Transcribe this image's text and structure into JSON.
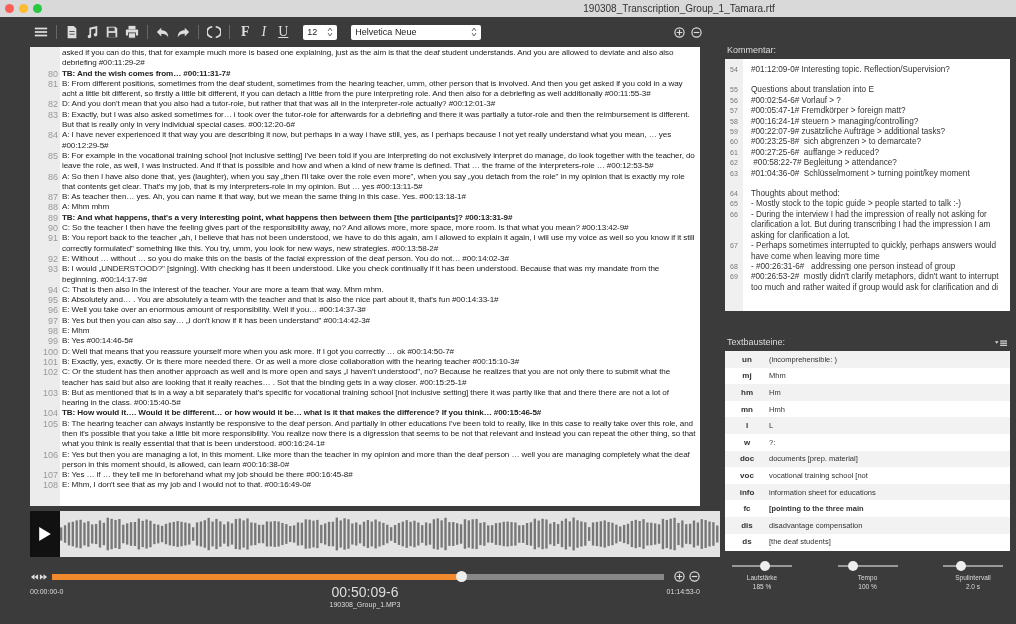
{
  "window": {
    "title": "190308_Transcription_Group_1_Tamara.rtf"
  },
  "toolbar": {
    "format_buttons": [
      {
        "label": "F",
        "kind": "bold"
      },
      {
        "label": "I",
        "kind": "italic"
      },
      {
        "label": "U",
        "kind": "underline"
      }
    ],
    "font_size": "12",
    "font": "Helvetica Neue"
  },
  "transcript": {
    "lines": [
      {
        "text": "asked if you can do this, that for example much more is based one explaining, just as the aim is that the deaf student understands. And you are allowed to deviate and also also debriefing  #00:11:29-2#",
        "bold": false
      },
      {
        "number": "80",
        "text": "TB: And the wish comes from…  #00:11:31-7#",
        "bold": true
      },
      {
        "number": "81",
        "text": "B: From different positions, sometimes from the deaf student, sometimes from the hearing teacher, umm, other person that is involved. And then you get asked if you cold in a way acht a little bit different, so firstly a little bit different, if you can detach a little from the pure interpreting role. And then also for a debriefing as well additionally  #00:11:55-3#",
        "bold": false
      },
      {
        "number": "82",
        "text": "D: And you don't mean that you also had a tutor-role, but rather that that was all in the interpreter-role actually?  #00:12:01-3#",
        "bold": false
      },
      {
        "number": "83",
        "text": "B: Exactly, but I was also asked sometimes for… i took over the tutor-role for afterwards for a debriefing and there it was partially a tutor-role and then the reimbursement is different. But that is really only in very individual special cases.  #00:12:20-6#",
        "bold": false
      },
      {
        "number": "84",
        "text": "A: I have never experienced it that way you are describing it now, but perhaps in a way i have still, yes, as I perhaps because I not yet really understand what you mean, … yes  #00:12:29-5#",
        "bold": false
      },
      {
        "number": "85",
        "text": "B: For example in the vocational training school [not inclusive setting] I've been told if you are interpreting do not exclusively interpret do manage, do look together with the teacher, do leave the role, as well, I was instructed. And if that is possible and how and when a kind of new frame is defined. That … the frame of the interpreters-role …  #00:12:53-5#",
        "bold": false
      },
      {
        "number": "86",
        "text": "A: So then I have also done that, yes (laughter), when you say „then I'll take over the role even more\", when you say „you detach from the role\" in my opinion that is exactly my role that contents get clear. That's my job, that is my interpreters-role in my opinion. But … yes #00:13:11-5#",
        "bold": false
      },
      {
        "number": "87",
        "text": "B: As teacher then… yes. Ah, you can name it that way, but we mean the same thing in this case. Yes.   #00:13:18-1#",
        "bold": false
      },
      {
        "number": "88",
        "text": "A: Mhm mhm",
        "bold": false
      },
      {
        "number": "89",
        "text": "TB: And what happens, that's a very interesting point, what happens then between them [the participants]?   #00:13:31-9#",
        "bold": true
      },
      {
        "number": "90",
        "text": "C: So the teacher I then have the feeling gives part of the responsibility away, no? And allows more, more space, more room. Is that what you mean?  #00:13:42-9#",
        "bold": false
      },
      {
        "number": "91",
        "text": "B: You report back to the teacher „ah, I believe that has not been understood, we have to do this again, am I allowed to explain it again, I will use my voice as well so you know if it still correctly formulated\" something like this. You try, umm, you look for new ways, new strategies.  #00:13:58-2#",
        "bold": false
      },
      {
        "number": "92",
        "text": "E: Without … without … so you do make this on the basis of the facial expression of the deaf person. You do not…  #00:14:02-3#",
        "bold": false
      },
      {
        "number": "93",
        "text": "B: I would „UNDERSTOOD?\" [signing]. With checking has it been understood. Like you check continually if it has been understood. Because that was my mandate from the beginning.  #00:14:17-9#",
        "bold": false
      },
      {
        "number": "94",
        "text": "C: That is then also in the interest of the teacher. Your are more a team that way. Mhm mhm.",
        "bold": false
      },
      {
        "number": "95",
        "text": "B: Absolutely and… . You are absolutely a team with the teacher and that is also the nice part about it, that's fun  #00:14:33-1#",
        "bold": false
      },
      {
        "number": "96",
        "text": "E: Well you take over an enormous amount of responsibility. Well if you…   #00:14:37-3#",
        "bold": false
      },
      {
        "number": "97",
        "text": "B: Yes but then you can also say… „I don't know if it has been understand\"  #00:14:42-3#",
        "bold": false
      },
      {
        "number": "98",
        "text": "E: Mhm",
        "bold": false
      },
      {
        "number": "99",
        "text": "B: Yes  #00:14:46-5#",
        "bold": false
      },
      {
        "number": "100",
        "text": "D: Well that means that you reassure yourself more when you ask more. If I got you correctly … ok  #00:14:50-7#",
        "bold": false
      },
      {
        "number": "101",
        "text": "B: Exactly, yes, exactly. Or is there more needed there. Or as well a more close collaboration with the hearing teacher  #00:15:10-3#",
        "bold": false
      },
      {
        "number": "102",
        "text": "C: Or the student has then another approach as well and is more open and says „I haven't understood\", no? Because he realizes that you are not only there to submit what the teacher has said but also are looking that it really reaches… . Sot that the binding gets in a way closer.  #00:15:25-1#",
        "bold": false
      },
      {
        "number": "103",
        "text": "B: But as mentioned that is in a way a bit separately that's specific for vocational training school [not inclusive setting] there it was partly like that and there there are not a lot of hearing in the class.  #00:15:40-5#",
        "bold": false
      },
      {
        "number": "104",
        "text": "TB: How would it…. Would it be different… or how would it be… what is it that makes the difference? If you think…  #00:15:46-5#",
        "bold": true
      },
      {
        "number": "105",
        "text": "B: The hearing teacher can always instantly be responsive to the deaf person. And partially in other educations I've been told to really, like in this case to really take over this role, and then it's possible that you take a little bit more responsibility. You realize now there is a digression that seems to be not that relevant and instead you can repeat the other thing, so that what you think is really essential that that is been understood.  #00:16:24-1#",
        "bold": false
      },
      {
        "number": "106",
        "text": "E: Yes but then you are managing a lot, in this moment. Like more than the teacher in my opinion and more than the deaf person … well you are managing completely what the deaf person in this moment should, is allowed, can learn    #00:16:38-0#",
        "bold": false
      },
      {
        "number": "107",
        "text": "B: Yes … if … they tell me in beforehand what my job should be there  #00:16:45-8#",
        "bold": false
      },
      {
        "number": "108",
        "text": "E: Mhm, I don't see that as my job and I would not to that.  #00:16:49-0#",
        "bold": false
      }
    ]
  },
  "player": {
    "start_time": "00:00:00-0",
    "current_time": "00:50:09-6",
    "end_time": "01:14:53-0",
    "file": "190308_Group_1.MP3",
    "level": 0.67
  },
  "comment_panel": {
    "title": "Kommentar:",
    "paragraphs": [
      [
        {
          "number": "54",
          "text": "#01:12:09-0# Interesting topic. Reflection/Supervision?"
        }
      ],
      [
        {
          "number": "55",
          "text": "Questions about translation into E"
        },
        {
          "number": "56",
          "text": "#00:02:54-6# Vorlauf > ?"
        },
        {
          "number": "57",
          "text": "#00:05:47-1# Fremdkörper > foreign matt?"
        },
        {
          "number": "58",
          "text": "#00:16:24-1# steuern > managing/controlling?"
        },
        {
          "number": "59",
          "text": "#00:22:07-9# zusätzliche Aufträge > additional tasks?"
        },
        {
          "number": "60",
          "text": "#00:23:25-8#  sich abgrenzen > to demarcate?"
        },
        {
          "number": "61",
          "text": "#00:27:25-6#  auffange > reduced?"
        },
        {
          "number": "62",
          "text": " #00:58:22-7# Begleitung > attendance?"
        },
        {
          "number": "63",
          "text": "#01:04:36-0#  Schlüsselmoment > turning point/key moment"
        }
      ],
      [
        {
          "number": "64",
          "text": "Thoughts about method:"
        },
        {
          "number": "65",
          "text": "- Mostly stock to the topic guide > people started to talk :-)"
        },
        {
          "number": "66",
          "text": "- During the interview I had the impression of really not asking for clarification a lot. But during transcribing I had the impression I am asking for clarification a lot."
        },
        {
          "number": "67",
          "text": "- Perhaps sometimes interrupted to quickly, perhaps answers would have come when leaving more time"
        },
        {
          "number": "68",
          "text": "- #00:26:31-6#   addressing one person instead of group"
        },
        {
          "number": "69",
          "text": "#00:26:53-2#  mostly didn't clarify metaphors, didn't want to interrupt too much and rather waited if group would ask for clarification and di"
        }
      ]
    ]
  },
  "snippets_panel": {
    "title": "Textbausteine:",
    "rows": [
      {
        "key": "un",
        "text": "(incomprehensible: )",
        "bold": false
      },
      {
        "key": "mj",
        "text": "Mhm",
        "bold": false
      },
      {
        "key": "hm",
        "text": "Hm",
        "bold": false
      },
      {
        "key": "mn",
        "text": "Hmh",
        "bold": false
      },
      {
        "key": "l",
        "text": "L",
        "bold": false
      },
      {
        "key": "w",
        "text": "?:",
        "bold": false
      },
      {
        "key": "doc",
        "text": "documents [prep. material]",
        "bold": false
      },
      {
        "key": "voc",
        "text": "vocational training school [not",
        "bold": false
      },
      {
        "key": "info",
        "text": "information sheet for educations",
        "bold": false
      },
      {
        "key": "fc",
        "text": "[pointing to the three main",
        "bold": true
      },
      {
        "key": "dis",
        "text": "disadvantage compensation",
        "bold": false
      },
      {
        "key": "ds",
        "text": "[the deaf students]",
        "bold": false
      }
    ]
  },
  "sliders": [
    {
      "label": "Lautstärke",
      "reading": "185 %",
      "level": 0.55
    },
    {
      "label": "Tempo",
      "reading": "100 %",
      "level": 0.25
    },
    {
      "label": "Spulintervall",
      "reading": "2.0 s",
      "level": 0.3
    }
  ]
}
